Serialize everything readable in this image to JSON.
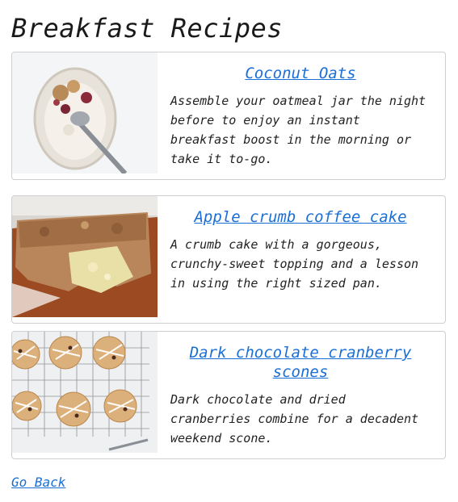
{
  "page": {
    "title": "Breakfast Recipes",
    "back_link": "Go Back"
  },
  "recipes": [
    {
      "title": "Coconut Oats",
      "description": "Assemble your oatmeal jar the night before to enjoy an instant breakfast boost in the morning or take it to-go."
    },
    {
      "title": "Apple crumb coffee cake",
      "description": "A crumb cake with a gorgeous, crunchy-sweet topping and a lesson in using the right sized pan."
    },
    {
      "title": "Dark chocolate cranberry scones",
      "description": "Dark chocolate and dried cranberries combine for a decadent weekend scone."
    }
  ],
  "colors": {
    "link": "#1a6fd6",
    "border": "#cfcfcf"
  }
}
